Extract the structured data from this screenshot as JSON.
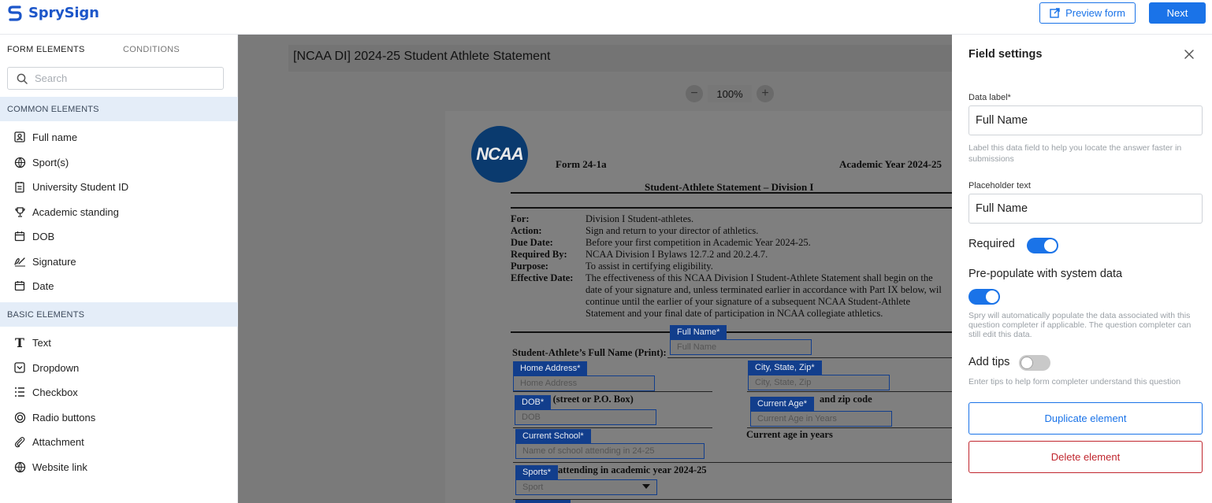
{
  "app": {
    "name": "SprySign"
  },
  "header": {
    "preview_label": "Preview form",
    "next_label": "Next"
  },
  "colors": {
    "accent": "#1a73e8",
    "brand": "#1c56c9",
    "danger": "#c0262e",
    "section_bg": "#e4edf8"
  },
  "sidebar": {
    "tabs": [
      "FORM ELEMENTS",
      "CONDITIONS"
    ],
    "search_placeholder": "Search",
    "common_heading": "COMMON ELEMENTS",
    "common_items": [
      {
        "label": "Full name",
        "icon": "person-badge-icon"
      },
      {
        "label": "Sport(s)",
        "icon": "ball-icon"
      },
      {
        "label": "University Student ID",
        "icon": "id-card-icon"
      },
      {
        "label": "Academic standing",
        "icon": "trophy-icon"
      },
      {
        "label": "DOB",
        "icon": "calendar-icon"
      },
      {
        "label": "Signature",
        "icon": "signature-icon"
      },
      {
        "label": "Date",
        "icon": "calendar-icon"
      }
    ],
    "basic_heading": "BASIC ELEMENTS",
    "basic_items": [
      {
        "label": "Text",
        "icon": "text-icon"
      },
      {
        "label": "Dropdown",
        "icon": "dropdown-icon"
      },
      {
        "label": "Checkbox",
        "icon": "checklist-icon"
      },
      {
        "label": "Radio buttons",
        "icon": "radio-icon"
      },
      {
        "label": "Attachment",
        "icon": "paperclip-icon"
      },
      {
        "label": "Website link",
        "icon": "globe-icon"
      }
    ]
  },
  "canvas": {
    "form_title": "[NCAA DI] 2024-25 Student Athlete Statement",
    "zoom": "100%",
    "document": {
      "logo_text": "NCAA",
      "form_number": "Form 24-1a",
      "academic_year": "Academic Year 2024-25",
      "heading": "Student-Athlete Statement – Division I",
      "rows": [
        {
          "key": "For:",
          "value": "Division I Student-athletes."
        },
        {
          "key": "Action:",
          "value": "Sign and return to your director of athletics."
        },
        {
          "key": "Due Date:",
          "value": "Before your first competition in Academic Year 2024-25."
        },
        {
          "key": "Required By:",
          "value": "NCAA Division I Bylaws 12.7.2 and 20.2.4.7."
        },
        {
          "key": "Purpose:",
          "value": "To assist in certifying eligibility."
        },
        {
          "key": "Effective Date:",
          "value": "The effectiveness of this NCAA Division I Student-Athlete Statement shall begin on the"
        }
      ],
      "effective_continued": [
        "date of your signature and, unless terminated earlier in accordance with Part IX below, wil",
        "continue until the earlier of your signature of a subsequent NCAA Student-Athlete",
        "Statement and your final date of participation in NCAA collegiate athletics."
      ],
      "full_name_print": "Student-Athlete’s Full Name (Print):",
      "address_caption": "ddress (street or P.O. Box)",
      "zip_caption": "and zip code",
      "current_age_caption": "Current age in years",
      "attending_caption": "attending in academic year 2024-25"
    },
    "fields": [
      {
        "tag": "Full Name*",
        "placeholder": "Full Name"
      },
      {
        "tag": "Home Address*",
        "placeholder": "Home Address"
      },
      {
        "tag": "City, State, Zip*",
        "placeholder": "City, State, Zip"
      },
      {
        "tag": "DOB*",
        "placeholder": "DOB"
      },
      {
        "tag": "Current Age*",
        "placeholder": "Current Age in Years"
      },
      {
        "tag": "Current School*",
        "placeholder": "Name of school attending in 24-25"
      },
      {
        "tag": "Sports*",
        "placeholder": "Sport"
      }
    ]
  },
  "panel": {
    "title": "Field settings",
    "data_label": {
      "label": "Data label*",
      "value": "Full Name",
      "help": "Label this data field to help you locate the answer faster in submissions"
    },
    "placeholder": {
      "label": "Placeholder text",
      "value": "Full Name"
    },
    "required": {
      "label": "Required",
      "on": true
    },
    "prepopulate": {
      "label": "Pre-populate with system data",
      "on": true,
      "help": "Spry will automatically populate the data associated with this question completer if applicable. The question completer can still edit this data."
    },
    "tips": {
      "label": "Add tips",
      "on": false,
      "help": "Enter tips to help form completer understand this question"
    },
    "duplicate_label": "Duplicate element",
    "delete_label": "Delete element"
  }
}
